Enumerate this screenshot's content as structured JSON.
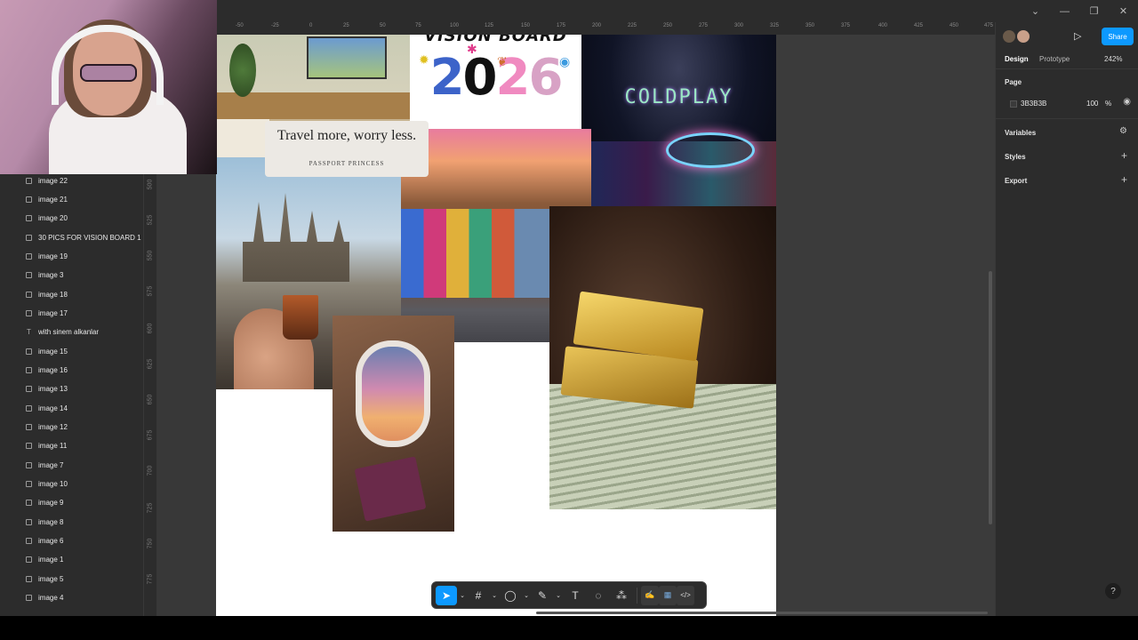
{
  "window": {
    "controls": [
      "⌄",
      "—",
      "❐",
      "✕"
    ]
  },
  "layers": [
    {
      "name": "image 22",
      "type": "image"
    },
    {
      "name": "image 21",
      "type": "image"
    },
    {
      "name": "image 20",
      "type": "image"
    },
    {
      "name": "30 PICS FOR VISION BOARD 1",
      "type": "image"
    },
    {
      "name": "image 19",
      "type": "image"
    },
    {
      "name": "image 3",
      "type": "image"
    },
    {
      "name": "image 18",
      "type": "image"
    },
    {
      "name": "image 17",
      "type": "image"
    },
    {
      "name": "with sinem alkanlar",
      "type": "text"
    },
    {
      "name": "image 15",
      "type": "image"
    },
    {
      "name": "image 16",
      "type": "image"
    },
    {
      "name": "image 13",
      "type": "image"
    },
    {
      "name": "image 14",
      "type": "image"
    },
    {
      "name": "image 12",
      "type": "image"
    },
    {
      "name": "image 11",
      "type": "image"
    },
    {
      "name": "image 7",
      "type": "image"
    },
    {
      "name": "image 10",
      "type": "image"
    },
    {
      "name": "image 9",
      "type": "image"
    },
    {
      "name": "image 8",
      "type": "image"
    },
    {
      "name": "image 6",
      "type": "image"
    },
    {
      "name": "image 1",
      "type": "image"
    },
    {
      "name": "image 5",
      "type": "image"
    },
    {
      "name": "image 4",
      "type": "image"
    }
  ],
  "ruler_top": [
    "-50",
    "-25",
    "0",
    "25",
    "50",
    "75",
    "100",
    "125",
    "150",
    "175",
    "200",
    "225",
    "250",
    "275",
    "300",
    "325",
    "350",
    "375",
    "400",
    "425",
    "450",
    "475"
  ],
  "ruler_left": [
    "500",
    "525",
    "550",
    "575",
    "600",
    "625",
    "650",
    "675",
    "700",
    "725",
    "750",
    "775"
  ],
  "board": {
    "vision_title": "VISION BOARD",
    "vision_year": [
      "2",
      "0",
      "2",
      "6"
    ],
    "coldplay": "COLDPLAY",
    "quote_main": "Travel more, worry less.",
    "quote_sub": "PASSPORT PRINCESS"
  },
  "right_panel": {
    "share": "Share",
    "tab_design": "Design",
    "tab_prototype": "Prototype",
    "zoom": "242%",
    "page_label": "Page",
    "page_color": "3B3B3B",
    "page_opacity": "100",
    "percent": "%",
    "variables": "Variables",
    "styles": "Styles",
    "export": "Export"
  },
  "toolbar": {
    "move": "➤",
    "frame": "#",
    "shape": "◯",
    "pen": "✎",
    "text": "T",
    "comment": "◌",
    "components": "⁂",
    "draw": "✍",
    "dev": "▦",
    "code": "</>"
  },
  "help": "?",
  "colors": {
    "accent": "#0d99ff",
    "canvas": "#3b3b3b",
    "panel": "#2c2c2c"
  }
}
